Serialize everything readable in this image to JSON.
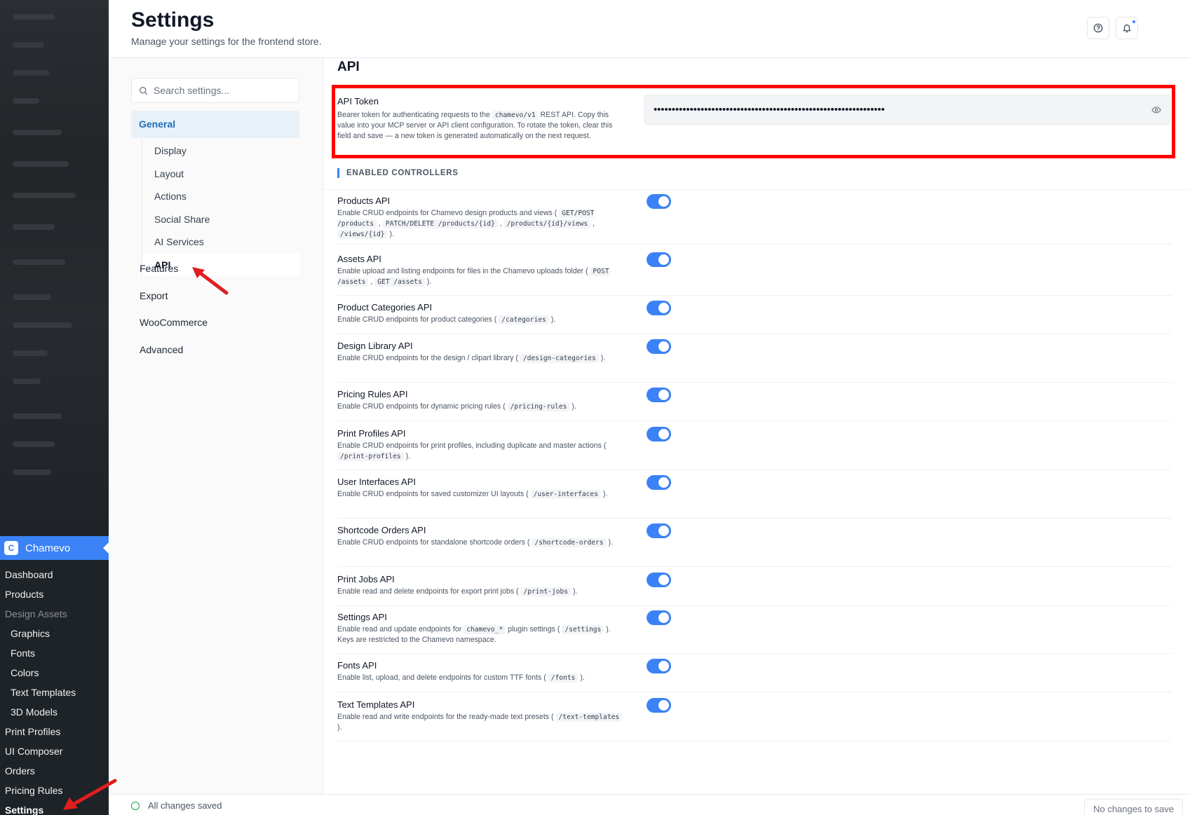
{
  "app": {
    "menu_active_label": "Chamevo",
    "menu_items": [
      {
        "label": "Dashboard",
        "kind": "top"
      },
      {
        "label": "Products",
        "kind": "top"
      },
      {
        "label": "Design Assets",
        "kind": "dim"
      },
      {
        "label": "Graphics",
        "kind": "sub"
      },
      {
        "label": "Fonts",
        "kind": "sub"
      },
      {
        "label": "Colors",
        "kind": "sub"
      },
      {
        "label": "Text Templates",
        "kind": "sub"
      },
      {
        "label": "3D Models",
        "kind": "sub"
      },
      {
        "label": "Print Profiles",
        "kind": "top"
      },
      {
        "label": "UI Composer",
        "kind": "top"
      },
      {
        "label": "Orders",
        "kind": "top"
      },
      {
        "label": "Pricing Rules",
        "kind": "top"
      },
      {
        "label": "Settings",
        "kind": "current"
      }
    ]
  },
  "header": {
    "title": "Settings",
    "subtitle": "Manage your settings for the frontend store."
  },
  "settings_nav": {
    "search_placeholder": "Search settings...",
    "general_label": "General",
    "sub_items": [
      "Display",
      "Layout",
      "Actions",
      "Social Share",
      "AI Services",
      "API"
    ],
    "active_sub": "API",
    "top_items": [
      "Features",
      "Export",
      "WooCommerce",
      "Advanced"
    ]
  },
  "section": {
    "title": "API",
    "token": {
      "label": "API Token",
      "desc_before": "Bearer token for authenticating requests to the ",
      "desc_code": "chamevo/v1",
      "desc_after": " REST API. Copy this value into your MCP server or API client configuration. To rotate the token, clear this field and save — a new token is generated automatically on the next request.",
      "masked_value": "••••••••••••••••••••••••••••••••••••••••••••••••••••••••••••••••"
    },
    "controllers_heading": "ENABLED CONTROLLERS",
    "controllers": [
      {
        "title": "Products API",
        "enabled": true,
        "desc": [
          [
            "t",
            "Enable CRUD endpoints for Chamevo design products and views ( "
          ],
          [
            "c",
            "GET/POST /products"
          ],
          [
            "t",
            " , "
          ],
          [
            "c",
            "PATCH/DELETE /products/{id}"
          ],
          [
            "t",
            " , "
          ],
          [
            "c",
            "/products/{id}/views"
          ],
          [
            "t",
            " , "
          ],
          [
            "c",
            "/views/{id}"
          ],
          [
            "t",
            " )."
          ]
        ]
      },
      {
        "title": "Assets API",
        "enabled": true,
        "desc": [
          [
            "t",
            "Enable upload and listing endpoints for files in the Chamevo uploads folder ( "
          ],
          [
            "c",
            "POST /assets"
          ],
          [
            "t",
            " , "
          ],
          [
            "c",
            "GET /assets"
          ],
          [
            "t",
            " )."
          ]
        ]
      },
      {
        "title": "Product Categories API",
        "enabled": true,
        "desc": [
          [
            "t",
            "Enable CRUD endpoints for product categories ( "
          ],
          [
            "c",
            "/categories"
          ],
          [
            "t",
            " )."
          ]
        ]
      },
      {
        "title": "Design Library API",
        "enabled": true,
        "desc": [
          [
            "t",
            "Enable CRUD endpoints for the design / clipart library ( "
          ],
          [
            "c",
            "/design-categories"
          ],
          [
            "t",
            " )."
          ]
        ]
      },
      {
        "title": "Pricing Rules API",
        "enabled": true,
        "desc": [
          [
            "t",
            "Enable CRUD endpoints for dynamic pricing rules ( "
          ],
          [
            "c",
            "/pricing-rules"
          ],
          [
            "t",
            " )."
          ]
        ]
      },
      {
        "title": "Print Profiles API",
        "enabled": true,
        "desc": [
          [
            "t",
            "Enable CRUD endpoints for print profiles, including duplicate and master actions ( "
          ],
          [
            "c",
            "/print-profiles"
          ],
          [
            "t",
            " )."
          ]
        ]
      },
      {
        "title": "User Interfaces API",
        "enabled": true,
        "desc": [
          [
            "t",
            "Enable CRUD endpoints for saved customizer UI layouts ( "
          ],
          [
            "c",
            "/user-interfaces"
          ],
          [
            "t",
            " )."
          ]
        ]
      },
      {
        "title": "Shortcode Orders API",
        "enabled": true,
        "desc": [
          [
            "t",
            "Enable CRUD endpoints for standalone shortcode orders ( "
          ],
          [
            "c",
            "/shortcode-orders"
          ],
          [
            "t",
            " )."
          ]
        ]
      },
      {
        "title": "Print Jobs API",
        "enabled": true,
        "desc": [
          [
            "t",
            "Enable read and delete endpoints for export print jobs ( "
          ],
          [
            "c",
            "/print-jobs"
          ],
          [
            "t",
            " )."
          ]
        ]
      },
      {
        "title": "Settings API",
        "enabled": true,
        "desc": [
          [
            "t",
            "Enable read and update endpoints for "
          ],
          [
            "c",
            "chamevo_*"
          ],
          [
            "t",
            " plugin settings ( "
          ],
          [
            "c",
            "/settings"
          ],
          [
            "t",
            " ). Keys are restricted to the Chamevo namespace."
          ]
        ]
      },
      {
        "title": "Fonts API",
        "enabled": true,
        "desc": [
          [
            "t",
            "Enable list, upload, and delete endpoints for custom TTF fonts ( "
          ],
          [
            "c",
            "/fonts"
          ],
          [
            "t",
            " )."
          ]
        ]
      },
      {
        "title": "Text Templates API",
        "enabled": true,
        "desc": [
          [
            "t",
            "Enable read and write endpoints for the ready-made text presets ( "
          ],
          [
            "c",
            "/text-templates"
          ],
          [
            "t",
            " )."
          ]
        ]
      }
    ]
  },
  "footer": {
    "status": "All changes saved",
    "save_label": "No changes to save"
  },
  "colors": {
    "accent": "#3b82f6",
    "highlight_box": "#ff0000",
    "annotation_arrow": "#e11d1d"
  }
}
